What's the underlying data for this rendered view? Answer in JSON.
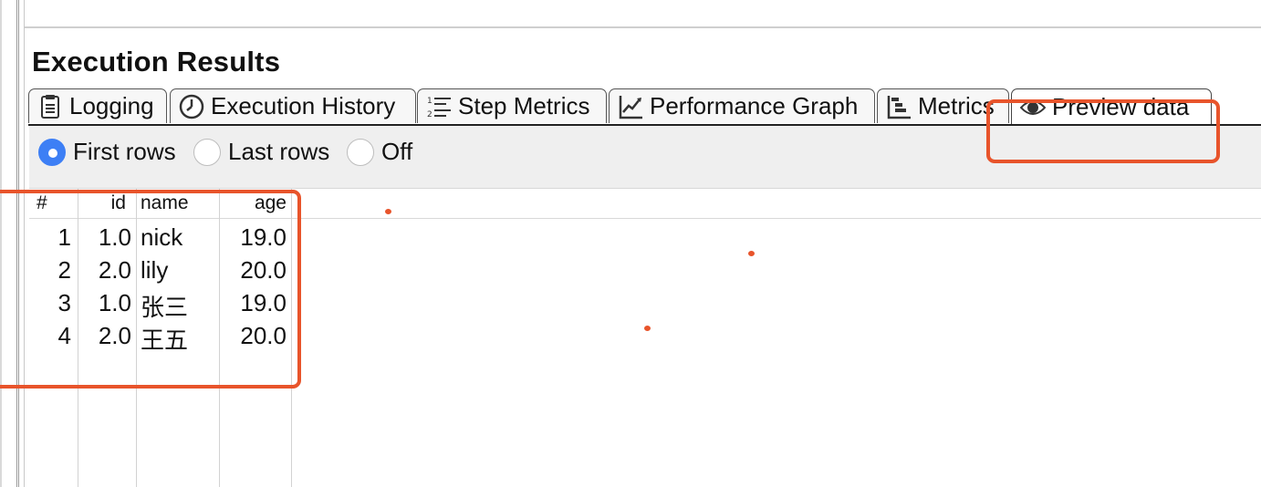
{
  "section_title": "Execution Results",
  "tabs": [
    {
      "label": "Logging",
      "icon": "logging-icon"
    },
    {
      "label": "Execution History",
      "icon": "clock-icon"
    },
    {
      "label": "Step Metrics",
      "icon": "numbered-list-icon"
    },
    {
      "label": "Performance Graph",
      "icon": "line-graph-icon"
    },
    {
      "label": "Metrics",
      "icon": "gantt-icon"
    },
    {
      "label": "Preview data",
      "icon": "eye-icon",
      "active": true
    }
  ],
  "preview_options": {
    "selected": "First rows",
    "items": [
      "First rows",
      "Last rows",
      "Off"
    ]
  },
  "table": {
    "headers": [
      "#",
      "id",
      "name",
      "age"
    ],
    "rows": [
      [
        "1",
        "1.0",
        "nick",
        "19.0"
      ],
      [
        "2",
        "2.0",
        "lily",
        "20.0"
      ],
      [
        "3",
        "1.0",
        "张三",
        "19.0"
      ],
      [
        "4",
        "2.0",
        "王五",
        "20.0"
      ]
    ]
  },
  "colors": {
    "annotation": "#e8542b",
    "radio_selected": "#3d7ff5",
    "toolbar_bg": "#efefef"
  }
}
